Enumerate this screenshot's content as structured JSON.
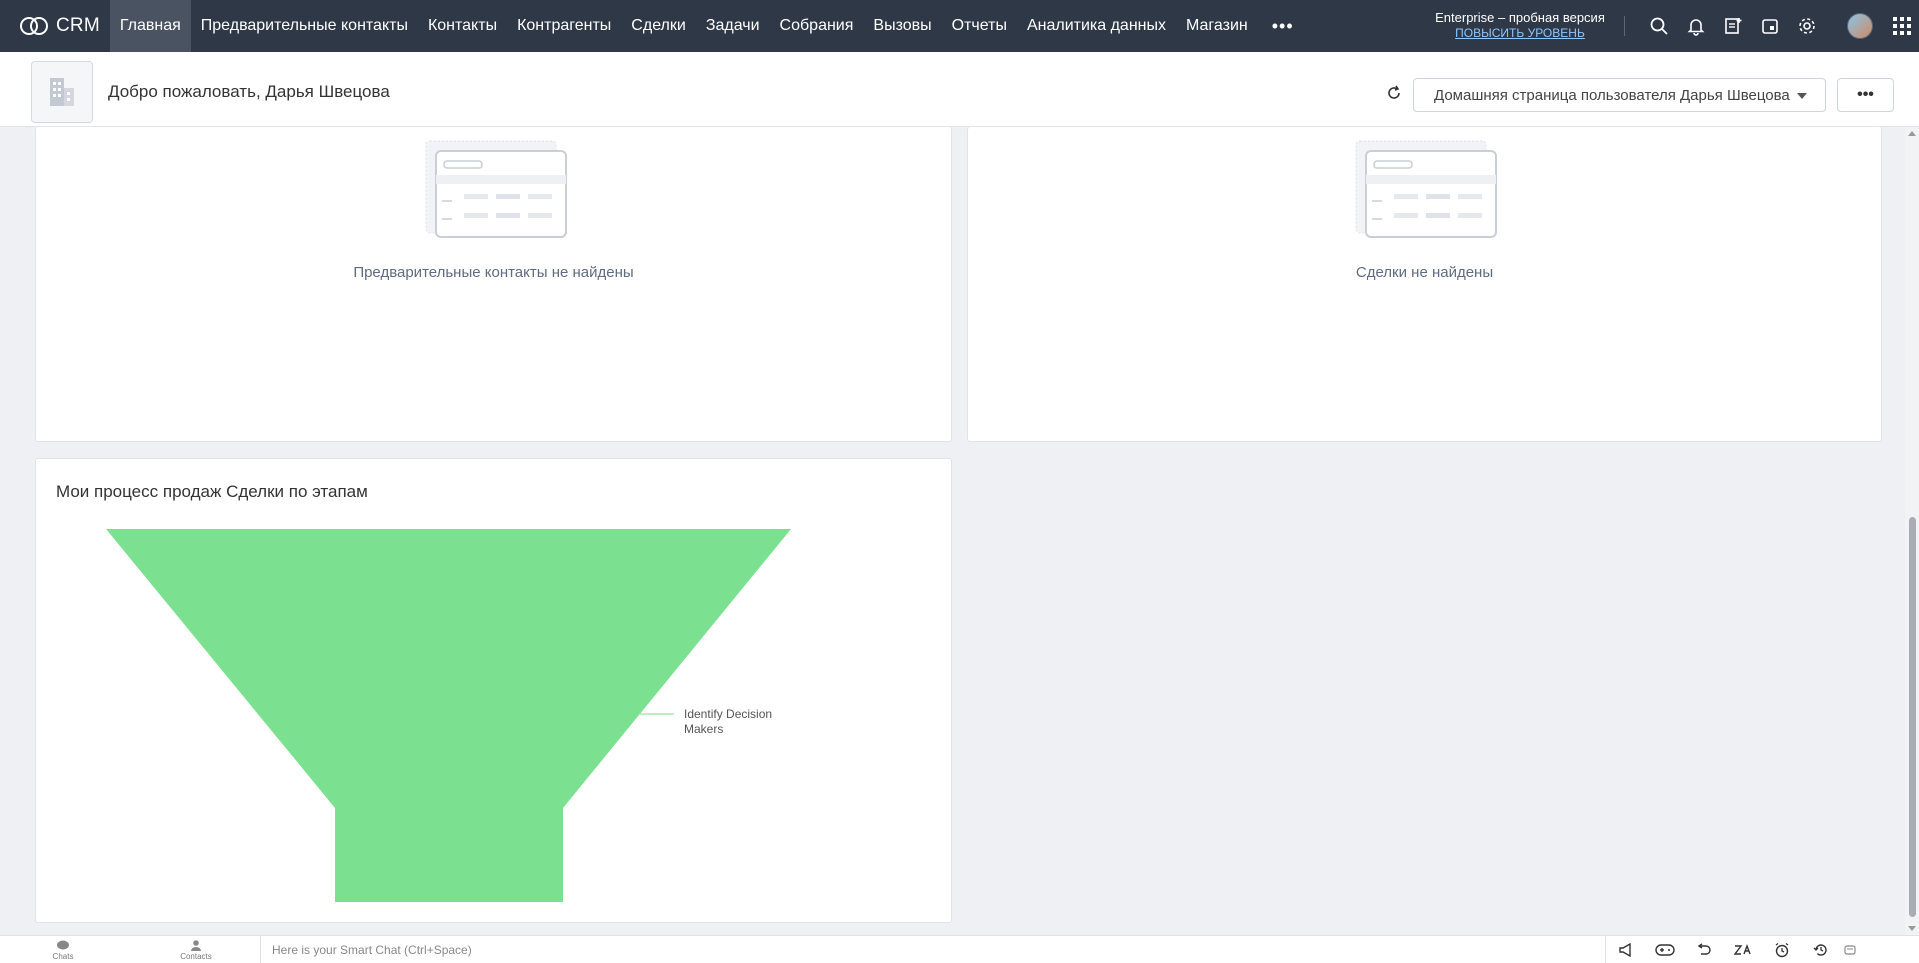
{
  "app": {
    "logo_text": "CRM"
  },
  "nav": {
    "tabs": [
      {
        "label": "Главная",
        "active": true
      },
      {
        "label": "Предварительные контакты"
      },
      {
        "label": "Контакты"
      },
      {
        "label": "Контрагенты"
      },
      {
        "label": "Сделки"
      },
      {
        "label": "Задачи"
      },
      {
        "label": "Собрания"
      },
      {
        "label": "Вызовы"
      },
      {
        "label": "Отчеты"
      },
      {
        "label": "Аналитика данных"
      },
      {
        "label": "Магазин"
      }
    ],
    "more_label": "•••",
    "edition_name": "Enterprise – пробная версия",
    "upgrade_label": "ПОВЫСИТЬ УРОВЕНЬ"
  },
  "header": {
    "welcome": "Добро пожаловать, Дарья Швецова",
    "home_page_select": "Домашняя страница пользователя Дарья Швецова",
    "more_label": "•••"
  },
  "cards": {
    "leads_empty": "Предварительные контакты не найдены",
    "deals_empty": "Сделки не найдены",
    "funnel_title": "Мои процесс продаж Сделки по этапам"
  },
  "chart_data": {
    "type": "funnel",
    "title": "Мои процесс продаж Сделки по этапам",
    "stages": [
      {
        "name": "Identify Decision Makers",
        "value": 1
      }
    ],
    "color": "#7be08f"
  },
  "footer": {
    "chats_label": "Chats",
    "contacts_label": "Contacts",
    "smart_chat_placeholder": "Here is your Smart Chat (Ctrl+Space)"
  },
  "colors": {
    "nav_bg": "#2f3846",
    "nav_active": "#4a5361",
    "upgrade_link": "#8ec6ff",
    "funnel": "#7be08f"
  }
}
